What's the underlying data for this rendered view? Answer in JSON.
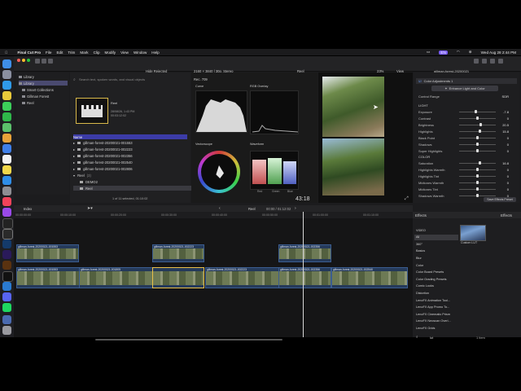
{
  "menubar": {
    "app_name": "Final Cut Pro",
    "items": [
      "File",
      "Edit",
      "Trim",
      "Mark",
      "Clip",
      "Modify",
      "View",
      "Window",
      "Help"
    ],
    "datetime": "Wed Aug 28  2:44 PM"
  },
  "toolbar": {
    "hide_rejected": "Hide Rejected",
    "format": "2160 × 3840 | 30p, Stereo",
    "library_name": "Reel",
    "zoom": "23%",
    "view_label": "View",
    "inspector_clip": "gillman-forest-20200021"
  },
  "sidebar": {
    "items": [
      {
        "label": "Library",
        "selected": false
      },
      {
        "label": "Library",
        "selected": true
      },
      {
        "label": "Smart Collections",
        "selected": false
      },
      {
        "label": "Gillman Forest",
        "selected": false
      },
      {
        "label": "Reel",
        "selected": false
      }
    ]
  },
  "browser": {
    "search_placeholder": "Search text, spoken words, and visual objects",
    "event_name": "Reel",
    "event_date": "28/08/26, 1:43 PM",
    "event_duration": "00:03:12:02",
    "list_header": "Name",
    "rows": [
      "gillman-forest-20200021-001553",
      "gillman-forest-20200021-002223",
      "gillman-forest-20200021-002356",
      "gillman-forest-20200021-002540",
      "gillman-forest-20200021-002806"
    ],
    "group_label": "Reel",
    "group_count": "(3)",
    "sub_rows": [
      "DEMO2",
      "Reel"
    ],
    "status": "1 of 11 selected, 01:10:02"
  },
  "scopes": {
    "rec": "Rec. 709",
    "curve_label": "Curve",
    "rgb_label": "RGB Overlay",
    "vectorscope_label": "Vectorscope",
    "waveform_label": "Waveform",
    "rgb_parade": [
      "Red",
      "Green",
      "Blue"
    ]
  },
  "viewer": {
    "timecode": "43:18"
  },
  "inspector": {
    "effect_name": "Color Adjustments 1",
    "enhance_button": "Enhance Light and Color",
    "control_range_label": "Control Range",
    "control_range_value": "SDR",
    "light_section": "LIGHT",
    "light_rows": [
      {
        "label": "Exposure",
        "value": "-7.8",
        "level": 0.45
      },
      {
        "label": "Contrast",
        "value": "0",
        "level": 0.5
      },
      {
        "label": "Brightness",
        "value": "20.5",
        "level": 0.6
      },
      {
        "label": "Highlights",
        "value": "15.8",
        "level": 0.58
      },
      {
        "label": "Black Point",
        "value": "0",
        "level": 0.5
      },
      {
        "label": "Shadows",
        "value": "0",
        "level": 0.5
      },
      {
        "label": "Super Highlights",
        "value": "0",
        "level": 0.5
      }
    ],
    "color_section": "COLOR",
    "color_rows": [
      {
        "label": "Saturation",
        "value": "16.8",
        "level": 0.58
      },
      {
        "label": "Highlights Warmth",
        "value": "0",
        "level": 0.5
      },
      {
        "label": "Highlights Tint",
        "value": "0",
        "level": 0.5
      },
      {
        "label": "Midtones Warmth",
        "value": "0",
        "level": 0.5
      },
      {
        "label": "Midtones Tint",
        "value": "0",
        "level": 0.5
      },
      {
        "label": "Shadows Warmth",
        "value": "0",
        "level": 0.5
      }
    ],
    "save_preset": "Save Effects Preset"
  },
  "timeline": {
    "index_label": "Index",
    "project_name": "Reel",
    "project_duration": "00:00 / 01:12:02",
    "ruler_ticks": [
      "00:00:00:00",
      "00:00:10:00",
      "00:00:20:00",
      "00:00:30:00",
      "00:00:40:00",
      "00:00:50:00",
      "00:01:00:00",
      "00:01:10:00"
    ],
    "upper_clips": [
      "gillman-forest-20200021-001553",
      "gillman-forest-20200021-002223",
      "gillman-forest-20200021-002356"
    ],
    "lower_clips": [
      "gillman-forest-20200021-001553",
      "gillman-forest-20200021-001805",
      "gillman-forest-20200021-002223",
      "gillman-forest-20200021-002356",
      "gillman-forest-20200021-002540"
    ]
  },
  "effects": {
    "title": "Effects",
    "installed": "Effects",
    "categories": [
      {
        "label": "VIDEO",
        "selected": false
      },
      {
        "label": "All",
        "selected": true
      },
      {
        "label": "360°",
        "selected": false
      },
      {
        "label": "Basics",
        "selected": false
      },
      {
        "label": "Blur",
        "selected": false
      },
      {
        "label": "Color",
        "selected": false
      },
      {
        "label": "Color Board Presets",
        "selected": false
      },
      {
        "label": "Color Grading Presets",
        "selected": false
      },
      {
        "label": "Comic Looks",
        "selected": false
      },
      {
        "label": "Distortion",
        "selected": false
      },
      {
        "label": "LenoFX Animation Tool...",
        "selected": false
      },
      {
        "label": "LenoFX App Promo To...",
        "selected": false
      },
      {
        "label": "LenoFX Cinematic Prism",
        "selected": false
      },
      {
        "label": "LenoFX Neoscan Overl...",
        "selected": false
      },
      {
        "label": "LenoFX Grids",
        "selected": false
      }
    ],
    "preview_label": "Custom LUT",
    "search_value": "lut",
    "count": "1 item"
  }
}
